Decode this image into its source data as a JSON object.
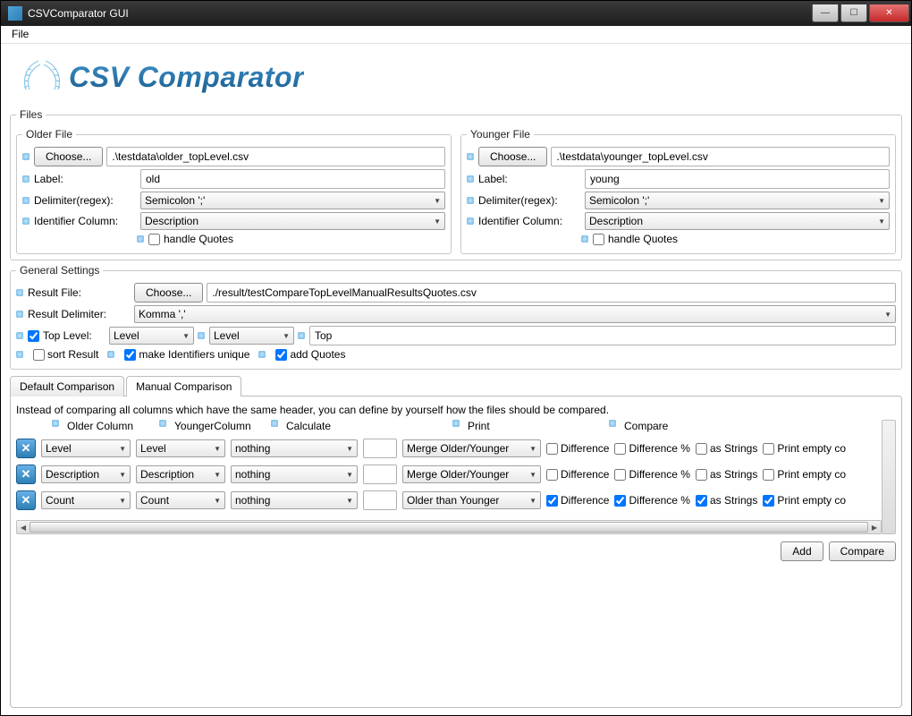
{
  "window": {
    "title": "CSVComparator GUI"
  },
  "menubar": {
    "file": "File"
  },
  "brand": "CSV Comparator",
  "files": {
    "legend": "Files",
    "older": {
      "legend": "Older File",
      "choose": "Choose...",
      "path": ".\\testdata\\older_topLevel.csv",
      "label_lbl": "Label:",
      "label_val": "old",
      "delimiter_lbl": "Delimiter(regex):",
      "delimiter_val": "Semicolon ';'",
      "idcol_lbl": "Identifier Column:",
      "idcol_val": "Description",
      "handle_quotes": "handle Quotes"
    },
    "younger": {
      "legend": "Younger File",
      "choose": "Choose...",
      "path": ".\\testdata\\younger_topLevel.csv",
      "label_lbl": "Label:",
      "label_val": "young",
      "delimiter_lbl": "Delimiter(regex):",
      "delimiter_val": "Semicolon ';'",
      "idcol_lbl": "Identifier Column:",
      "idcol_val": "Description",
      "handle_quotes": "handle Quotes"
    }
  },
  "general": {
    "legend": "General Settings",
    "result_file_lbl": "Result File:",
    "result_file_btn": "Choose...",
    "result_file_val": "./result/testCompareTopLevelManualResultsQuotes.csv",
    "result_delim_lbl": "Result Delimiter:",
    "result_delim_val": "Komma ','",
    "toplevel_lbl": "Top Level:",
    "toplevel_sel1": "Level",
    "toplevel_sel2": "Level",
    "toplevel_txt": "Top",
    "sort_result": "sort Result",
    "make_unique": "make Identifiers unique",
    "add_quotes": "add Quotes"
  },
  "tabs": {
    "default": "Default Comparison",
    "manual": "Manual Comparison"
  },
  "manual": {
    "desc": "Instead of comparing all columns which have the same header, you can define by yourself how the files should be compared.",
    "headers": {
      "older": "Older Column",
      "younger": "YoungerColumn",
      "calc": "Calculate",
      "print": "Print",
      "compare": "Compare"
    },
    "rows": [
      {
        "older": "Level",
        "younger": "Level",
        "calc": "nothing",
        "num": "",
        "print": "Merge Older/Younger",
        "diff": false,
        "diffpct": false,
        "asstr": false,
        "printempty": false
      },
      {
        "older": "Description",
        "younger": "Description",
        "calc": "nothing",
        "num": "",
        "print": "Merge Older/Younger",
        "diff": false,
        "diffpct": false,
        "asstr": false,
        "printempty": false
      },
      {
        "older": "Count",
        "younger": "Count",
        "calc": "nothing",
        "num": "",
        "print": "Older than Younger",
        "diff": true,
        "diffpct": true,
        "asstr": true,
        "printempty": true
      }
    ],
    "chk_labels": {
      "diff": "Difference",
      "diffpct": "Difference %",
      "asstr": "as Strings",
      "printempty": "Print empty co"
    }
  },
  "footer": {
    "add": "Add",
    "compare": "Compare"
  }
}
